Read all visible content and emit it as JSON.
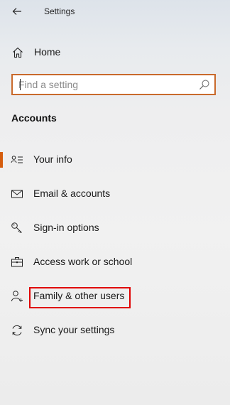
{
  "window": {
    "title": "Settings",
    "back_icon": "back-arrow-icon"
  },
  "nav": {
    "home_label": "Home",
    "home_icon": "home-icon"
  },
  "search": {
    "placeholder": "Find a setting",
    "value": "",
    "icon": "search-icon",
    "border_color": "#c96a2c"
  },
  "section": {
    "title": "Accounts"
  },
  "menu": {
    "accent_color": "#d55d0e",
    "highlight_color": "#e00000",
    "items": [
      {
        "label": "Your info",
        "icon": "contact-card-icon",
        "selected": true
      },
      {
        "label": "Email & accounts",
        "icon": "mail-icon",
        "selected": false
      },
      {
        "label": "Sign-in options",
        "icon": "key-icon",
        "selected": false
      },
      {
        "label": "Access work or school",
        "icon": "briefcase-icon",
        "selected": false
      },
      {
        "label": "Family & other users",
        "icon": "add-person-icon",
        "selected": false,
        "highlighted": true
      },
      {
        "label": "Sync your settings",
        "icon": "sync-icon",
        "selected": false
      }
    ]
  }
}
